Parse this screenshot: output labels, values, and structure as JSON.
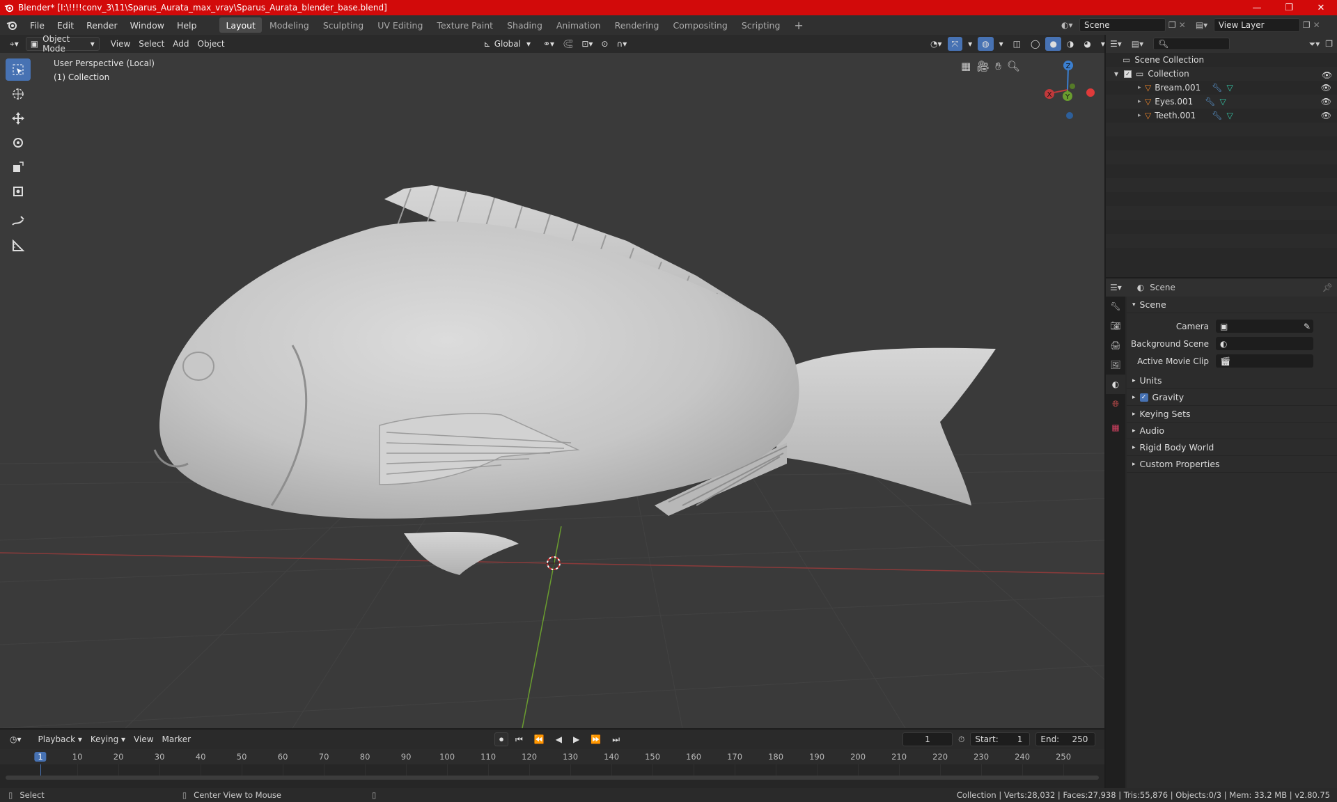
{
  "title": "Blender* [I:\\!!!!conv_3\\11\\Sparus_Aurata_max_vray\\Sparus_Aurata_blender_base.blend]",
  "menu": [
    "File",
    "Edit",
    "Render",
    "Window",
    "Help"
  ],
  "workspaces": [
    "Layout",
    "Modeling",
    "Sculpting",
    "UV Editing",
    "Texture Paint",
    "Shading",
    "Animation",
    "Rendering",
    "Compositing",
    "Scripting"
  ],
  "active_workspace": "Layout",
  "scene_field": "Scene",
  "view_layer_field": "View Layer",
  "viewport_header": {
    "mode": "Object Mode",
    "menus": [
      "View",
      "Select",
      "Add",
      "Object"
    ],
    "transform_orientation": "Global"
  },
  "viewport": {
    "perspective_label": "User Perspective (Local)",
    "collection_label": "(1) Collection",
    "gizmo_axes": {
      "z": "Z",
      "y": "Y",
      "x": "X"
    }
  },
  "outliner": {
    "root": "Scene Collection",
    "collection": "Collection",
    "objects": [
      "Bream.001",
      "Eyes.001",
      "Teeth.001"
    ]
  },
  "properties": {
    "header_title": "Scene",
    "panel_title": "Scene",
    "rows": [
      {
        "label": "Camera",
        "value": ""
      },
      {
        "label": "Background Scene",
        "value": ""
      },
      {
        "label": "Active Movie Clip",
        "value": ""
      }
    ],
    "subpanels": [
      "Units",
      "Gravity",
      "Keying Sets",
      "Audio",
      "Rigid Body World",
      "Custom Properties"
    ],
    "gravity_checked": true
  },
  "timeline": {
    "menus": [
      "Playback",
      "Keying",
      "View",
      "Marker"
    ],
    "current_frame": "1",
    "start_label": "Start:",
    "start_value": "1",
    "end_label": "End:",
    "end_value": "250",
    "ruler_ticks": [
      "1",
      "10",
      "20",
      "30",
      "40",
      "50",
      "60",
      "70",
      "80",
      "90",
      "100",
      "110",
      "120",
      "130",
      "140",
      "150",
      "160",
      "170",
      "180",
      "190",
      "200",
      "210",
      "220",
      "230",
      "240",
      "250"
    ]
  },
  "statusbar": {
    "left_action": "Select",
    "middle_action": "Center View to Mouse",
    "stats": "Collection | Verts:28,032 | Faces:27,938 | Tris:55,876 | Objects:0/3 | Mem: 33.2 MB | v2.80.75"
  },
  "colors": {
    "titlebar": "#d20a0a",
    "accent": "#4772b3",
    "x_axis": "#c0393b",
    "y_axis": "#6a9d2f",
    "z_axis": "#3b7fd0",
    "object_icon": "#e8822a",
    "mesh_icon": "#35c4a5"
  }
}
